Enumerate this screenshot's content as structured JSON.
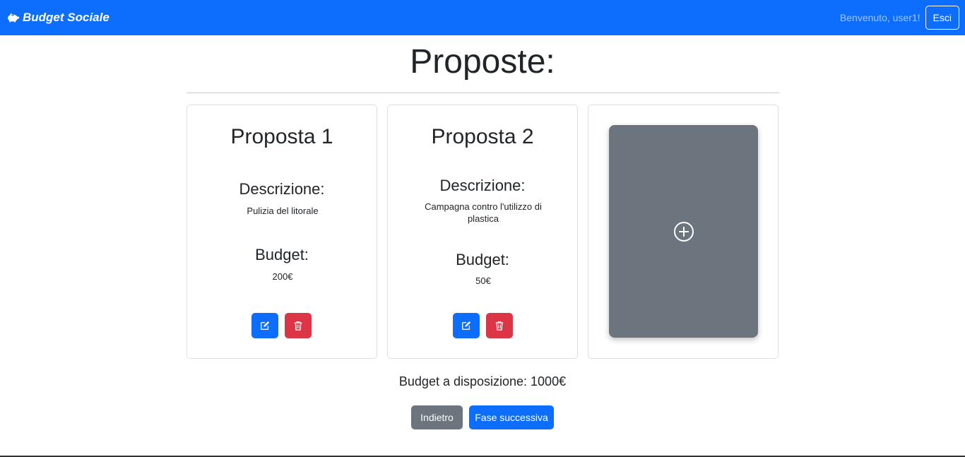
{
  "navbar": {
    "brand": "Budget Sociale",
    "welcome": "Benvenuto, user1!",
    "logout_label": "Esci"
  },
  "page": {
    "title": "Proposte:"
  },
  "proposals": [
    {
      "title": "Proposta 1",
      "description_label": "Descrizione:",
      "description": "Pulizia del litorale",
      "budget_label": "Budget:",
      "budget": "200€"
    },
    {
      "title": "Proposta 2",
      "description_label": "Descrizione:",
      "description": "Campagna contro l'utilizzo di plastica",
      "budget_label": "Budget:",
      "budget": "50€"
    }
  ],
  "footer": {
    "available_budget": "Budget a disposizione: 1000€",
    "back_label": "Indietro",
    "next_label": "Fase successiva"
  },
  "colors": {
    "primary": "#0d6efd",
    "secondary": "#6c757d",
    "danger": "#dc3545"
  },
  "icons": {
    "brand": "piggy-bank-icon",
    "edit": "edit-icon",
    "delete": "trash-icon",
    "add": "plus-circle-icon"
  }
}
